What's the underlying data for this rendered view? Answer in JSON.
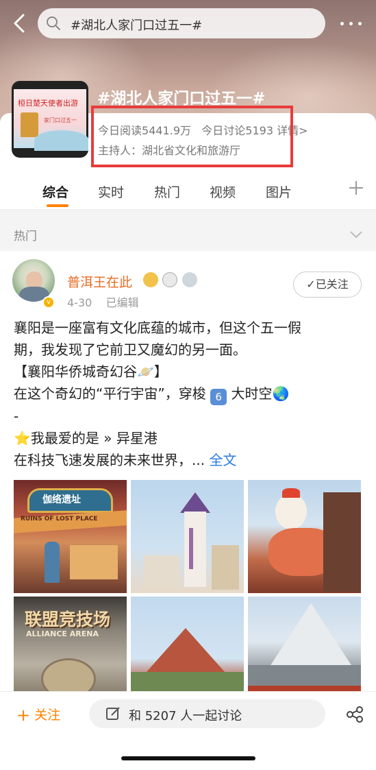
{
  "nav": {
    "search_text": "#湖北人家门口过五一#"
  },
  "topic": {
    "title": "#湖北人家门口过五一#",
    "avatar_text": "桓日楚天使者出游",
    "avatar_subtext": "家门口过五一",
    "read_label": "今日阅读",
    "read_value": "5441.9万",
    "discuss_label": "今日讨论",
    "discuss_value": "5193",
    "detail_link": "详情>",
    "host_label": "主持人：",
    "host_name": "湖北省文化和旅游厅"
  },
  "tabs": [
    {
      "label": "综合",
      "active": true
    },
    {
      "label": "实时",
      "active": false
    },
    {
      "label": "热门",
      "active": false
    },
    {
      "label": "视频",
      "active": false
    },
    {
      "label": "图片",
      "active": false
    }
  ],
  "section": {
    "label": "热门"
  },
  "post": {
    "author": "普洱王在此",
    "date": "4-30",
    "edited": "已编辑",
    "follow_state": "✓已关注",
    "lines": [
      "襄阳是一座富有文化底蕴的城市，但这个五一假",
      "期，我发现了它前卫又魔幻的另一面。",
      "【襄阳华侨城奇幻谷🪐】",
      "在这个奇幻的“平行宇宙”，穿梭",
      "大时空🌏",
      "-",
      "⭐我最爱的是 » 异星港",
      "在科技飞速发展的未来世界，... ",
      "全文"
    ],
    "emoji_number": "6",
    "image_captions": [
      "伽络遗址",
      "RUINS OF LOST PLACE",
      "联盟竞技场",
      "ALLIANCE ARENA"
    ]
  },
  "bottom": {
    "follow": "关注",
    "discuss": "和 5207 人一起讨论"
  },
  "colors": {
    "accent": "#ff8200",
    "author": "#e86b22",
    "link": "#2a7ae2",
    "highlight": "#e93b3b"
  }
}
